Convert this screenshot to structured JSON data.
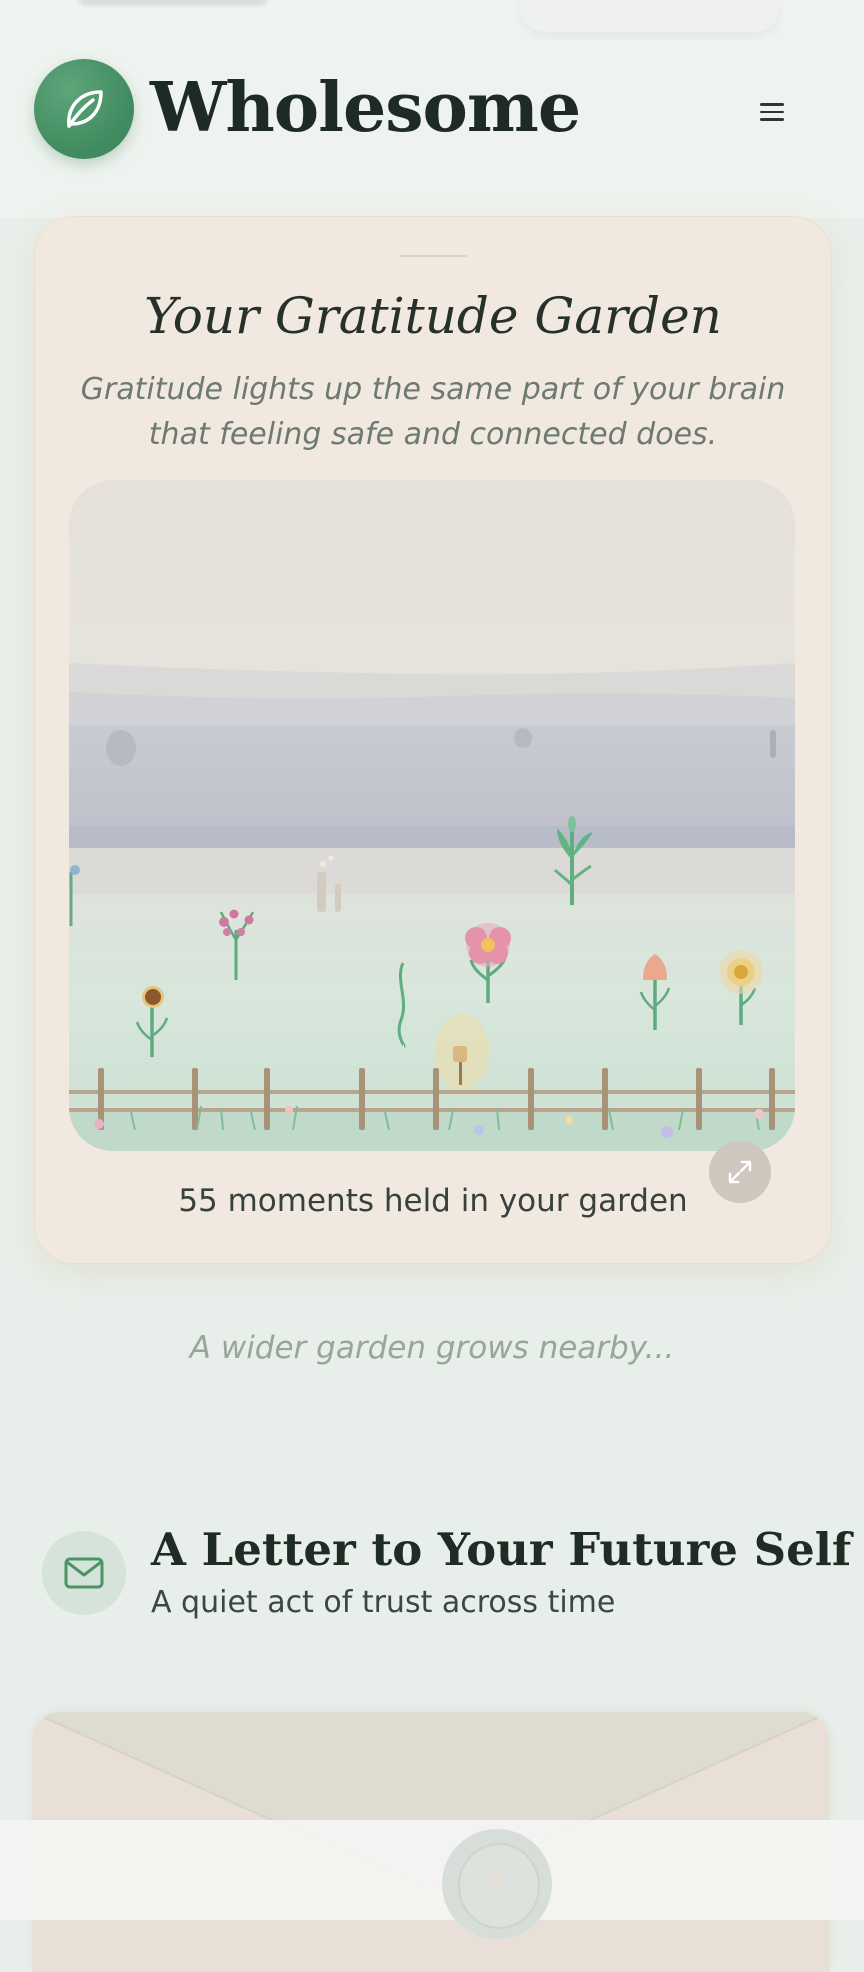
{
  "header": {
    "brand": "Wholesome",
    "logo_icon": "leaf-icon",
    "menu_icon": "hamburger-icon"
  },
  "gratitude": {
    "title": "Your Gratitude Garden",
    "subtitle": "Gratitude lights up the same part of your brain that feeling safe and connected does.",
    "moments_text": "55 moments held in your garden",
    "expand_icon": "expand-icon"
  },
  "wider_text": "A wider garden grows nearby...",
  "letter": {
    "icon": "mail-icon",
    "title": "A Letter to Your Future Self",
    "subtitle": "A quiet act of trust across time"
  },
  "colors": {
    "page_bg": "#e8efea",
    "brand_green": "#4a9468",
    "card_bg": "#f1e9e0",
    "text_dark": "#1f2d26",
    "muted": "#98a49c"
  }
}
